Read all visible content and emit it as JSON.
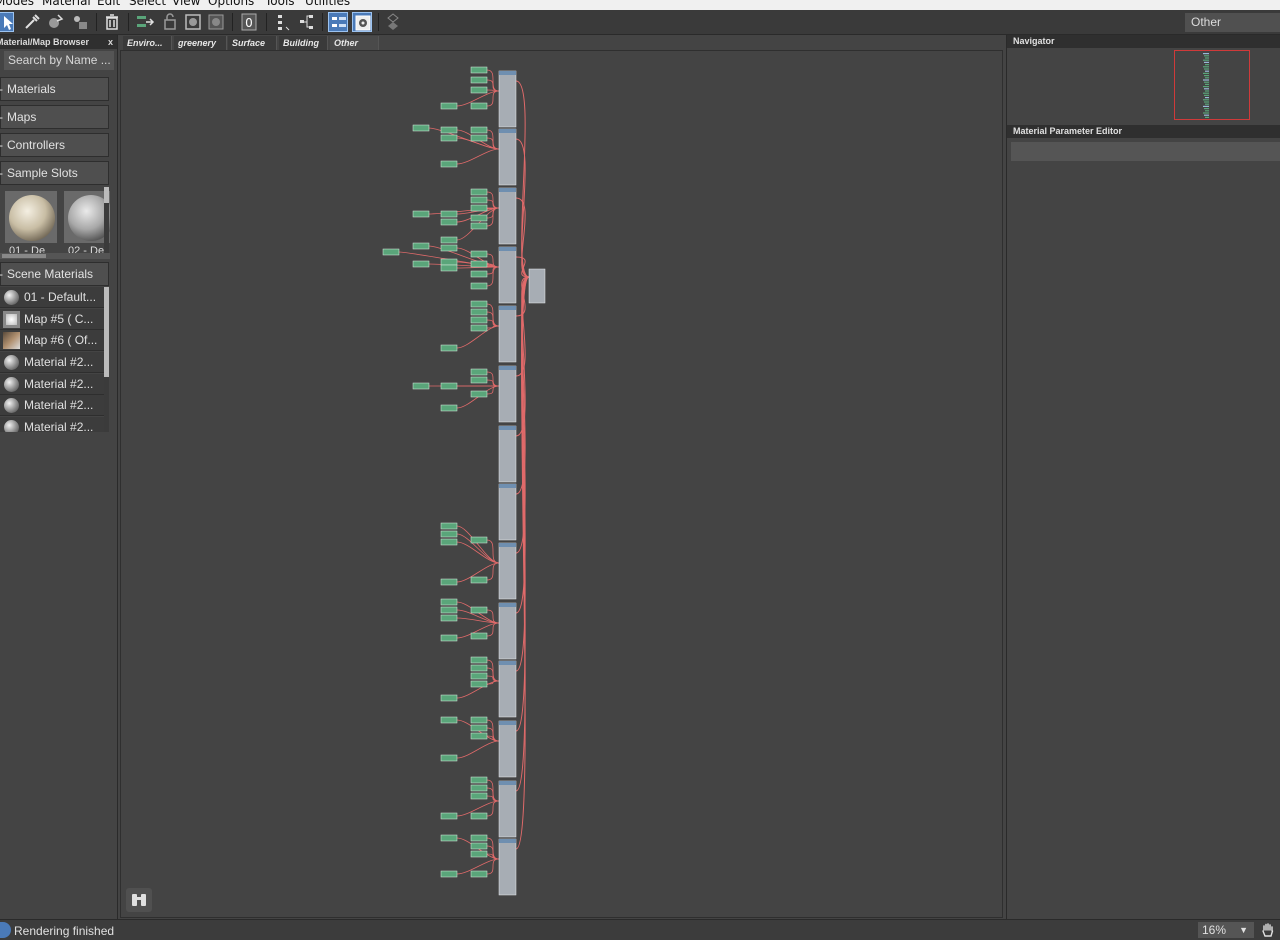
{
  "menubar": {
    "items": [
      "Modes",
      "Material",
      "Edit",
      "Select",
      "View",
      "Options",
      "Tools",
      "Utilities"
    ]
  },
  "toolbar": {
    "view_selector": "Other",
    "icons": [
      "select-tool-icon",
      "eyedropper-icon",
      "put-to-scene-icon",
      "assign-to-selection-icon",
      "delete-icon",
      "move-children-icon",
      "hide-unused-icon",
      "show-map-icon",
      "show-background-icon",
      "sample-slot-zero-icon",
      "layout-all-icon",
      "layout-children-icon",
      "material-map-browser-toggle-icon",
      "parameter-editor-toggle-icon",
      "select-by-material-icon"
    ]
  },
  "browser": {
    "title": "Material/Map Browser",
    "close": "x",
    "search_placeholder": "Search by Name ...",
    "rollout_prefix": "-",
    "rollouts": {
      "materials": "Materials",
      "maps": "Maps",
      "controllers": "Controllers",
      "sample_slots": "Sample Slots",
      "scene_materials": "Scene Materials"
    },
    "sample_slots": [
      {
        "label": "01 - De"
      },
      {
        "label": "02 - De"
      }
    ],
    "scene_materials": [
      {
        "label": "01 - Default...",
        "icon": "material-sphere-icon"
      },
      {
        "label": "Map #5  ( C...",
        "icon": "map-icon"
      },
      {
        "label": "Map #6  ( Of...",
        "icon": "bitmap-map-icon"
      },
      {
        "label": "Material  #2...",
        "icon": "material-sphere-icon"
      },
      {
        "label": "Material  #2...",
        "icon": "material-sphere-icon"
      },
      {
        "label": "Material  #2...",
        "icon": "material-sphere-icon"
      },
      {
        "label": "Material  #2...",
        "icon": "material-sphere-icon"
      }
    ]
  },
  "view_tabs": [
    {
      "label": "Enviro...",
      "active": false
    },
    {
      "label": "greenery",
      "active": false
    },
    {
      "label": "Surface",
      "active": false
    },
    {
      "label": "Building",
      "active": false
    },
    {
      "label": "Other",
      "active": true
    }
  ],
  "navigator": {
    "title": "Navigator"
  },
  "parameter_editor": {
    "title": "Material Parameter Editor"
  },
  "status": {
    "text": "Rendering finished",
    "zoom": "16%"
  },
  "colors": {
    "link": "#e06a6a",
    "map_node": "#5aa57a",
    "material_node": "#a7adb4",
    "navigator_frame": "#d03a3a",
    "active_toggle": "#4a7ab8"
  }
}
